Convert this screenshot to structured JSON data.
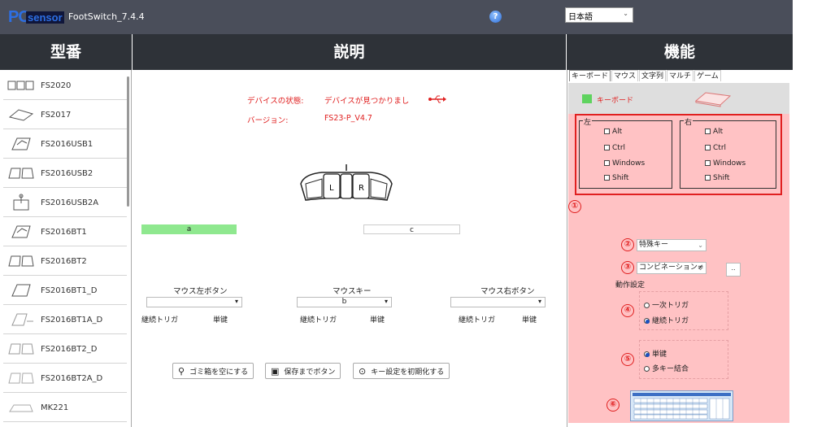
{
  "app": {
    "brand_pc": "PC",
    "brand_sensor": "sensor",
    "title": "FootSwitch_7.4.4",
    "help_glyph": "?",
    "language": "日本語"
  },
  "headers": {
    "model": "型番",
    "description": "説明",
    "function": "機能"
  },
  "models": [
    "FS2020",
    "FS2017",
    "FS2016USB1",
    "FS2016USB2",
    "FS2016USB2A",
    "FS2016BT1",
    "FS2016BT2",
    "FS2016BT1_D",
    "FS2016BT1A_D",
    "FS2016BT2_D",
    "FS2016BT2A_D",
    "MK221"
  ],
  "device": {
    "status_label": "デバイスの状態:",
    "status_value": "デバイスが見つかりまし",
    "version_label": "バージョン:",
    "version_value": "FS23-P_V4.7"
  },
  "pedal": {
    "left": "L",
    "right": "R"
  },
  "keys": {
    "left": "a",
    "right": "c",
    "middle": "b"
  },
  "controls": {
    "mouse_left": "マウス左ボタン",
    "mouse_key": "マウスキー",
    "mouse_right": "マウス右ボタン",
    "continuous": "継続トリガ",
    "single": "単键"
  },
  "buttons": {
    "trash": "ゴミ箱を空にする",
    "save": "保存までボタン",
    "reset": "キー設定を初期化する"
  },
  "tabs": [
    "キーボード",
    "マウス",
    "文字列",
    "マルチ",
    "ゲーム"
  ],
  "func": {
    "keyboard_label": "キーボード",
    "group_left": "左",
    "group_right": "右",
    "modifiers": [
      "Alt",
      "Ctrl",
      "Windows",
      "Shift"
    ],
    "num1": "①",
    "num2": "②",
    "num3": "③",
    "num4": "④",
    "num5": "⑤",
    "num6": "⑥",
    "special_key": "特殊キー",
    "combination": "コンビネーション≠",
    "more": "..",
    "action_label": "動作設定",
    "trigger_once": "一次トリガ",
    "trigger_continuous": "継続トリガ",
    "key_single": "単键",
    "key_multi": "多キー結合"
  },
  "colors": {
    "titlebar": "#4a4e5a",
    "header": "#2e3238",
    "accent_red": "#e02020",
    "panel_pink": "#ffc2c4",
    "key_green": "#8fe88f"
  }
}
